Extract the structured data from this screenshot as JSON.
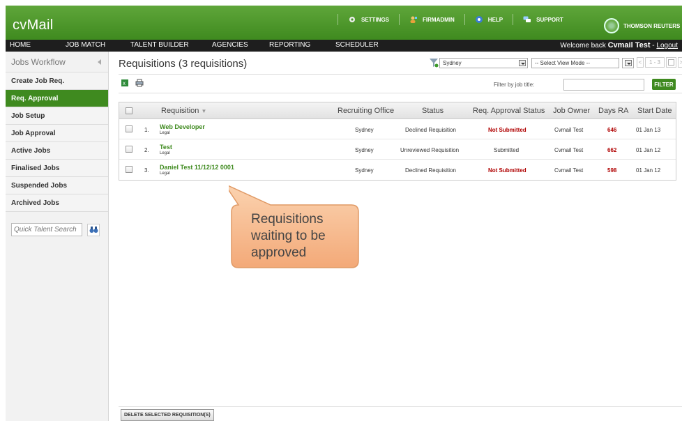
{
  "app": {
    "title": "cvMail"
  },
  "toplinks": [
    {
      "label": "SETTINGS",
      "icon": "gear-icon"
    },
    {
      "label": "FIRMADMIN",
      "icon": "admin-user-icon"
    },
    {
      "label": "HELP",
      "icon": "help-icon"
    },
    {
      "label": "SUPPORT",
      "icon": "support-chat-icon"
    }
  ],
  "brand": "THOMSON REUTERS",
  "nav": {
    "items": [
      "HOME",
      "JOB MATCH",
      "TALENT BUILDER",
      "AGENCIES",
      "REPORTING",
      "SCHEDULER"
    ],
    "welcome_prefix": "Welcome back ",
    "user": "Cvmail Test",
    "sep": " - ",
    "logout": "Logout"
  },
  "sidebar": {
    "header": "Jobs Workflow",
    "items": [
      "Create Job Req.",
      "Req. Approval",
      "Job Setup",
      "Job Approval",
      "Active Jobs",
      "Finalised Jobs",
      "Suspended Jobs",
      "Archived Jobs"
    ],
    "active_index": 1,
    "search_placeholder": "Quick Talent Search"
  },
  "main": {
    "title": "Requisitions (3 requisitions)",
    "office_select": "Sydney",
    "view_mode_select": "-- Select View Mode --",
    "pager": {
      "prev": "<",
      "range": "1 - 3",
      "next": ">"
    },
    "filter_label": "Filter by job title:",
    "filter_value": "",
    "filter_button": "FILTER",
    "delete_button": "DELETE SELECTED REQUISITION(S)"
  },
  "table": {
    "columns": {
      "requisition": "Requisition",
      "office": "Recruiting Office",
      "status": "Status",
      "approval": "Req. Approval Status",
      "owner": "Job Owner",
      "days": "Days RA",
      "start": "Start Date"
    },
    "rows": [
      {
        "num": "1.",
        "name": "Web Developer",
        "dept": "Legal",
        "office": "Sydney",
        "status": "Declined Requisition",
        "approval": "Not Submitted",
        "owner": "Cvmail Test",
        "days": "646",
        "start": "01 Jan 13"
      },
      {
        "num": "2.",
        "name": "Test",
        "dept": "Legal",
        "office": "Sydney",
        "status": "Unreviewed Requisition",
        "approval": "Submitted",
        "owner": "Cvmail Test",
        "days": "662",
        "start": "01 Jan 12"
      },
      {
        "num": "3.",
        "name": "Daniel Test 11/12/12 0001",
        "dept": "Legal",
        "office": "Sydney",
        "status": "Declined Requisition",
        "approval": "Not Submitted",
        "owner": "Cvmail Test",
        "days": "598",
        "start": "01 Jan 12"
      }
    ]
  },
  "callout": {
    "lines": [
      "Requisitions",
      "waiting to be",
      "approved"
    ]
  },
  "colors": {
    "brand_green": "#3f8a1f",
    "nav_dark": "#1e1e1e",
    "alert_red": "#b00000",
    "callout_orange": "#f6b98a"
  }
}
